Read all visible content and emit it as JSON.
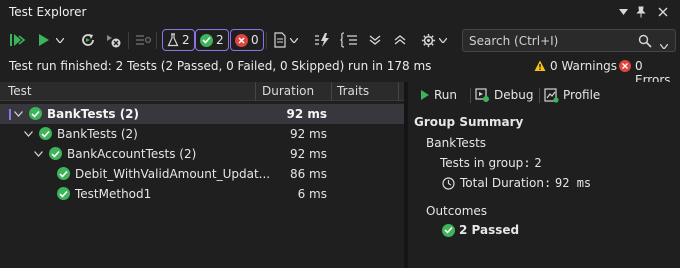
{
  "window": {
    "title": "Test Explorer"
  },
  "toolbar": {
    "total_count": "2",
    "passed_count": "2",
    "failed_count": "0",
    "search_placeholder": "Search (Ctrl+I)"
  },
  "status": {
    "message": "Test run finished: 2 Tests (2 Passed, 0 Failed, 0 Skipped) run in 178 ms",
    "warnings": "0 Warnings",
    "errors": "0 Errors"
  },
  "tree": {
    "columns": {
      "test": "Test",
      "duration": "Duration",
      "traits": "Traits"
    },
    "rows": [
      {
        "label": "BankTests (2)",
        "duration": "92 ms"
      },
      {
        "label": "BankTests (2)",
        "duration": "92 ms"
      },
      {
        "label": "BankAccountTests (2)",
        "duration": "92 ms"
      },
      {
        "label": "Debit_WithValidAmount_Updat...",
        "duration": "86 ms"
      },
      {
        "label": "TestMethod1",
        "duration": "6 ms"
      }
    ]
  },
  "detail": {
    "run_label": "Run",
    "debug_label": "Debug",
    "profile_label": "Profile",
    "group_summary_title": "Group Summary",
    "group_name": "BankTests",
    "tests_in_group_label": "Tests in group",
    "tests_in_group_value": "2",
    "total_duration_label": "Total Duration",
    "total_duration_value": "92 ms",
    "outcomes_title": "Outcomes",
    "passed_outcome": "2 Passed"
  },
  "colors": {
    "accent": "#8c73e6",
    "pass": "#3db35a",
    "fail": "#e0443e",
    "warn": "#f2c21b"
  }
}
